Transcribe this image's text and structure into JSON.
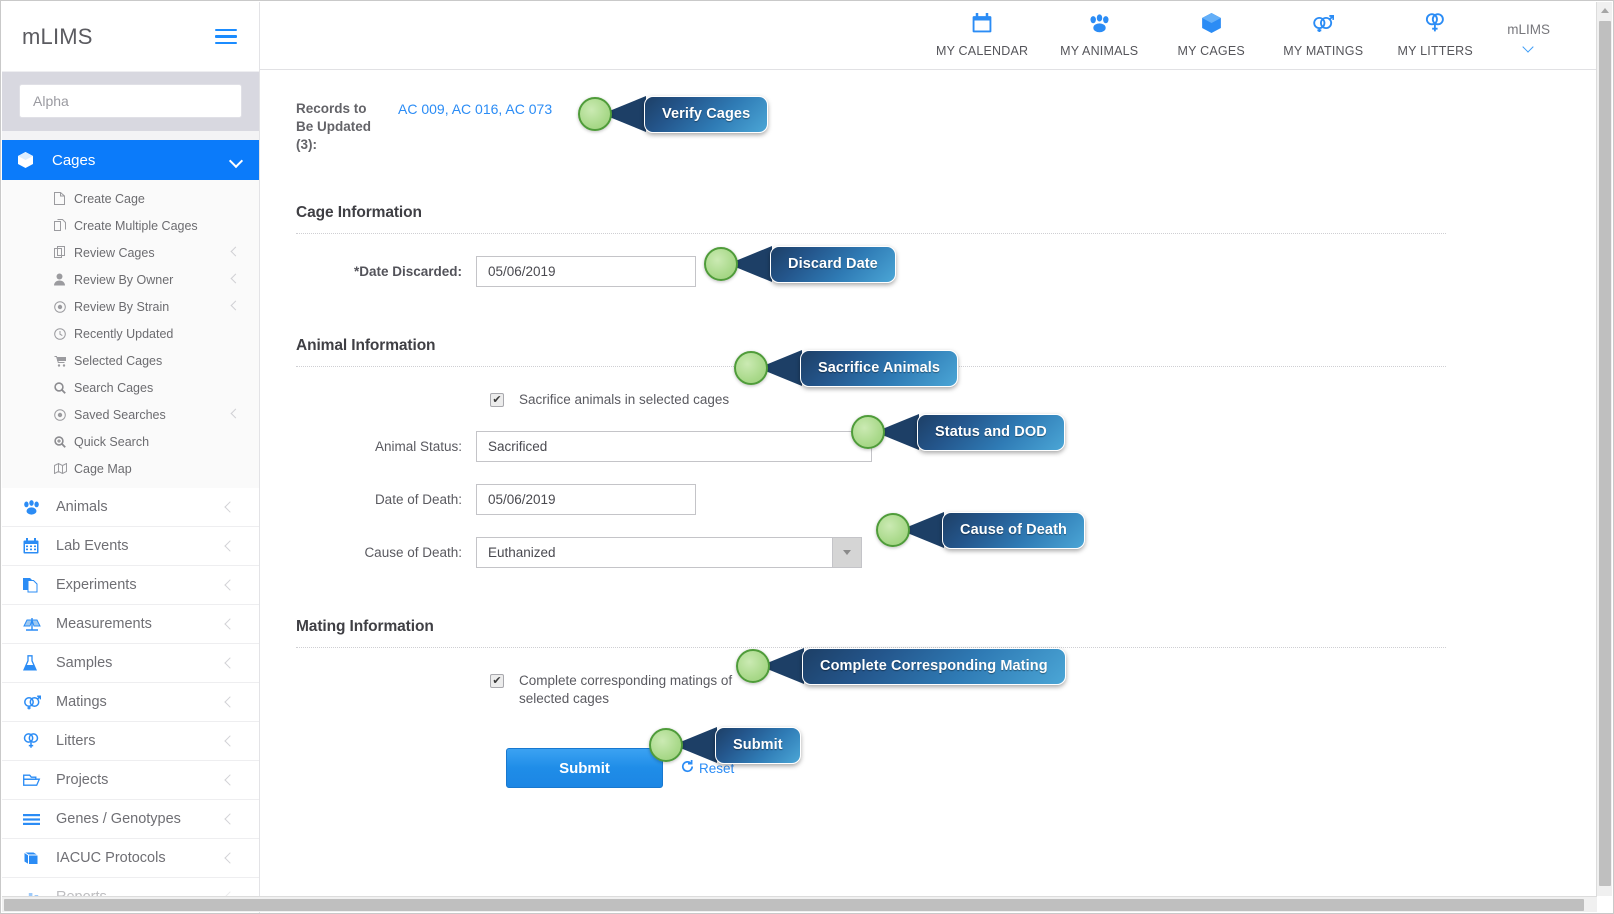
{
  "sidebar": {
    "brand": "mLIMS",
    "hamburger_icon": "hamburger-menu-icon",
    "search": {
      "placeholder": "Alpha",
      "value": ""
    },
    "active_group": {
      "label": "Cages",
      "icon": "cube-icon",
      "expand_icon": "chevron-down-icon",
      "accent_color": "#0b7bfa"
    },
    "submenu": [
      {
        "label": "Create Cage",
        "icon": "file-icon",
        "has_arrow": false
      },
      {
        "label": "Create Multiple Cages",
        "icon": "copy-files-icon",
        "has_arrow": false
      },
      {
        "label": "Review Cages",
        "icon": "copy-icon",
        "has_arrow": true
      },
      {
        "label": "Review By Owner",
        "icon": "user-icon",
        "has_arrow": true
      },
      {
        "label": "Review By Strain",
        "icon": "target-icon",
        "has_arrow": true
      },
      {
        "label": "Recently Updated",
        "icon": "clock-icon",
        "has_arrow": false
      },
      {
        "label": "Selected Cages",
        "icon": "cart-icon",
        "has_arrow": false
      },
      {
        "label": "Search Cages",
        "icon": "magnifier-icon",
        "has_arrow": false
      },
      {
        "label": "Saved Searches",
        "icon": "target-icon",
        "has_arrow": true
      },
      {
        "label": "Quick Search",
        "icon": "magnifier-plus-icon",
        "has_arrow": false
      },
      {
        "label": "Cage Map",
        "icon": "map-icon",
        "has_arrow": false
      }
    ],
    "nav": [
      {
        "label": "Animals",
        "icon": "paw-icon"
      },
      {
        "label": "Lab Events",
        "icon": "calendar-icon"
      },
      {
        "label": "Experiments",
        "icon": "documents-icon"
      },
      {
        "label": "Measurements",
        "icon": "scales-icon"
      },
      {
        "label": "Samples",
        "icon": "flask-icon"
      },
      {
        "label": "Matings",
        "icon": "male-female-icon"
      },
      {
        "label": "Litters",
        "icon": "double-female-icon"
      },
      {
        "label": "Projects",
        "icon": "folder-icon"
      },
      {
        "label": "Genes / Genotypes",
        "icon": "list-icon"
      },
      {
        "label": "IACUC Protocols",
        "icon": "book-icon"
      },
      {
        "label": "Reports",
        "icon": "bar-chart-icon"
      }
    ]
  },
  "topbar": {
    "items": [
      {
        "label": "MY CALENDAR",
        "icon": "calendar-icon"
      },
      {
        "label": "MY ANIMALS",
        "icon": "paw-icon"
      },
      {
        "label": "MY CAGES",
        "icon": "cube-icon"
      },
      {
        "label": "MY MATINGS",
        "icon": "male-female-icon"
      },
      {
        "label": "MY LITTERS",
        "icon": "double-female-icon"
      }
    ],
    "user": {
      "label": "mLIMS",
      "chevron_icon": "chevron-down-icon"
    }
  },
  "main": {
    "records": {
      "label": "Records to Be Updated (3):",
      "value": "AC 009, AC 016, AC 073",
      "count": 3
    },
    "sections": {
      "cage": {
        "title": "Cage Information",
        "date_discarded": {
          "label": "*Date Discarded:",
          "value": "05/06/2019"
        }
      },
      "animal": {
        "title": "Animal Information",
        "sacrifice_checkbox": {
          "label": "Sacrifice animals in selected cages",
          "checked": true,
          "check_glyph": "✔"
        },
        "animal_status": {
          "label": "Animal Status:",
          "value": "Sacrificed"
        },
        "date_of_death": {
          "label": "Date of Death:",
          "value": "05/06/2019"
        },
        "cause_of_death": {
          "label": "Cause of Death:",
          "value": "Euthanized",
          "dropdown_icon": "caret-down-icon"
        }
      },
      "mating": {
        "title": "Mating Information",
        "complete_checkbox": {
          "label": "Complete corresponding matings of selected cages",
          "checked": true,
          "check_glyph": "✔"
        }
      }
    },
    "actions": {
      "submit_label": "Submit",
      "reset_label": "Reset",
      "reset_icon": "refresh-icon"
    }
  },
  "callouts": [
    {
      "text": "Verify Cages"
    },
    {
      "text": "Discard Date"
    },
    {
      "text": "Sacrifice Animals"
    },
    {
      "text": "Status and DOD"
    },
    {
      "text": "Cause of Death"
    },
    {
      "text": "Complete Corresponding Mating"
    },
    {
      "text": "Submit"
    }
  ],
  "colors": {
    "accent_blue": "#2b8cf5",
    "active_nav": "#0b7bfa",
    "callout_badge_dark": "#1d3f66",
    "callout_badge_light": "#4ba6d6",
    "callout_dot_fill": "#a9d98a",
    "callout_dot_border": "#4f9c3a"
  }
}
